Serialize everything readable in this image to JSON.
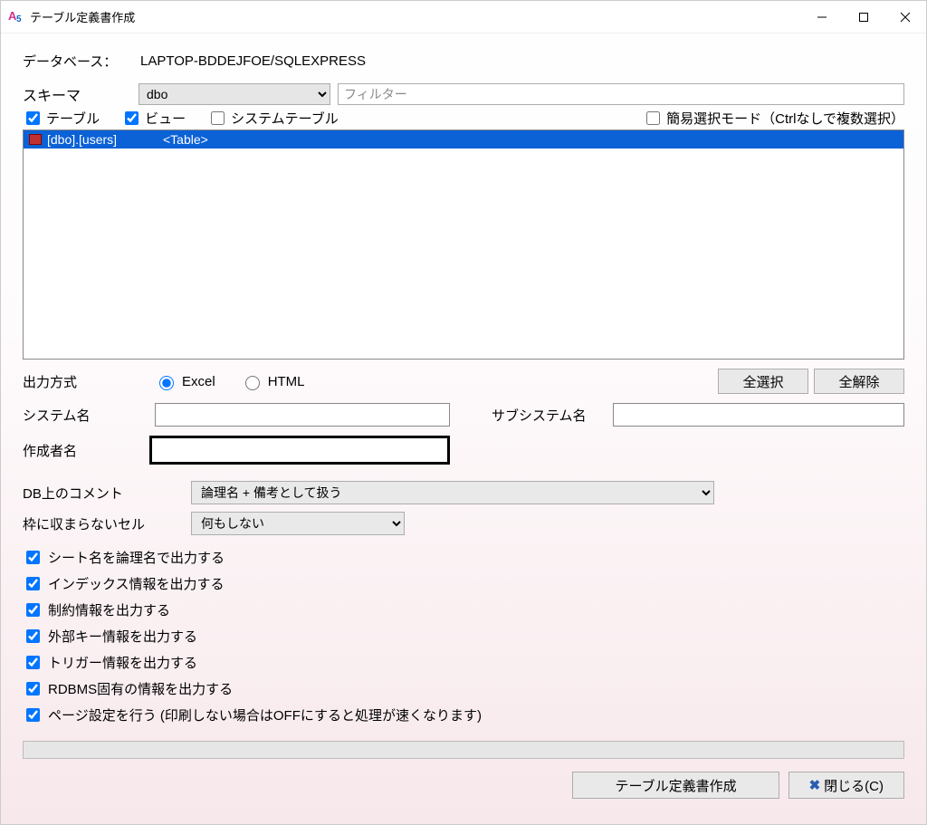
{
  "window": {
    "title": "テーブル定義書作成"
  },
  "db": {
    "label": "データベース：",
    "value": "LAPTOP-BDDEJFOE/SQLEXPRESS"
  },
  "schema": {
    "label": "スキーマ",
    "selected": "dbo"
  },
  "filter": {
    "placeholder": "フィルター"
  },
  "typeChecks": {
    "table": "テーブル",
    "view": "ビュー",
    "system": "システムテーブル",
    "simpleMode": "簡易選択モード（Ctrlなしで複数選択）"
  },
  "list": {
    "items": [
      {
        "object": "[dbo].[users]",
        "type": "<Table>"
      }
    ]
  },
  "output": {
    "label": "出力方式",
    "excel": "Excel",
    "html": "HTML",
    "selectAll": "全選択",
    "deselectAll": "全解除"
  },
  "fields": {
    "systemName": "システム名",
    "subsystemName": "サブシステム名",
    "authorName": "作成者名"
  },
  "comment": {
    "label": "DB上のコメント",
    "selected": "論理名 + 備考として扱う"
  },
  "overflow": {
    "label": "枠に収まらないセル",
    "selected": "何もしない"
  },
  "options": [
    "シート名を論理名で出力する",
    "インデックス情報を出力する",
    "制約情報を出力する",
    "外部キー情報を出力する",
    "トリガー情報を出力する",
    "RDBMS固有の情報を出力する",
    "ページ設定を行う (印刷しない場合はOFFにすると処理が速くなります)"
  ],
  "buttons": {
    "generate": "テーブル定義書作成",
    "close": "閉じる(C)"
  }
}
